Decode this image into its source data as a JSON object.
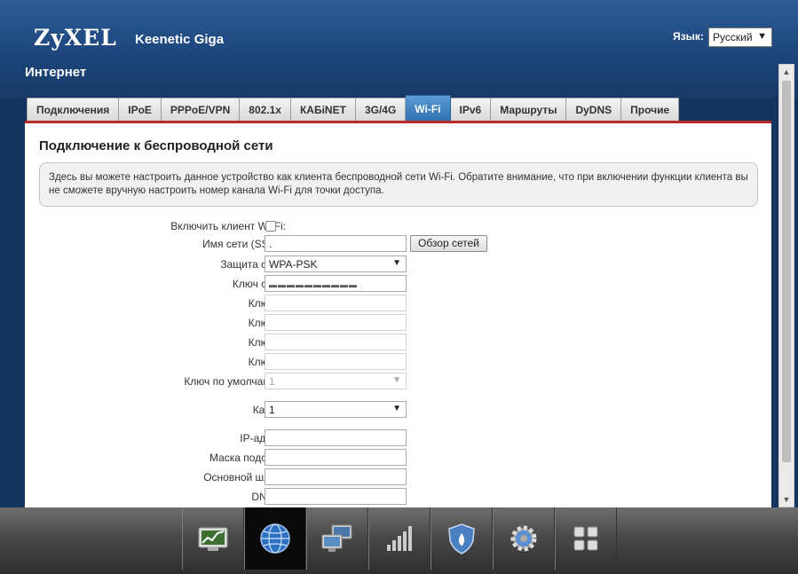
{
  "header": {
    "logo": "ZyXEL",
    "model": "Keenetic Giga",
    "language_label": "Язык:",
    "language_value": "Русский",
    "page_title": "Интернет"
  },
  "tabs": [
    {
      "label": "Подключения",
      "active": false
    },
    {
      "label": "IPoE",
      "active": false
    },
    {
      "label": "PPPoE/VPN",
      "active": false
    },
    {
      "label": "802.1x",
      "active": false
    },
    {
      "label": "КАБiNET",
      "active": false
    },
    {
      "label": "3G/4G",
      "active": false
    },
    {
      "label": "Wi-Fi",
      "active": true
    },
    {
      "label": "IPv6",
      "active": false
    },
    {
      "label": "Маршруты",
      "active": false
    },
    {
      "label": "DyDNS",
      "active": false
    },
    {
      "label": "Прочие",
      "active": false
    }
  ],
  "section": {
    "title": "Подключение к беспроводной сети",
    "info": "Здесь вы можете настроить данное устройство как клиента беспроводной сети Wi-Fi. Обратите внимание, что при включении функции клиента вы не сможете вручную настроить номер канала Wi-Fi для точки доступа."
  },
  "form": {
    "enable_client_label": "Включить клиент Wi-Fi:",
    "ssid_label": "Имя сети (SSID):",
    "ssid_value": ".",
    "scan_button": "Обзор сетей",
    "security_label": "Защита сети:",
    "security_value": "WPA-PSK",
    "network_key_label": "Ключ сети:",
    "network_key_value": "▬▬▬▬▬▬▬▬▬▬",
    "key1_label": "Ключ 1:",
    "key2_label": "Ключ 2:",
    "key3_label": "Ключ 3:",
    "key4_label": "Ключ 4:",
    "default_key_label": "Ключ по умолчанию:",
    "default_key_value": "1",
    "channel_label": "Канал:",
    "channel_value": "1",
    "ip_label": "IP-адрес:",
    "mask_label": "Маска подсети:",
    "gateway_label": "Основной шлюз:",
    "dns1_label": "DNS 1:"
  },
  "dock": [
    {
      "icon": "monitor-chart-icon",
      "active": false
    },
    {
      "icon": "globe-icon",
      "active": true
    },
    {
      "icon": "computers-icon",
      "active": false
    },
    {
      "icon": "signal-bars-icon",
      "active": false
    },
    {
      "icon": "shield-icon",
      "active": false
    },
    {
      "icon": "gear-icon",
      "active": false
    },
    {
      "icon": "grid-icon",
      "active": false
    }
  ]
}
